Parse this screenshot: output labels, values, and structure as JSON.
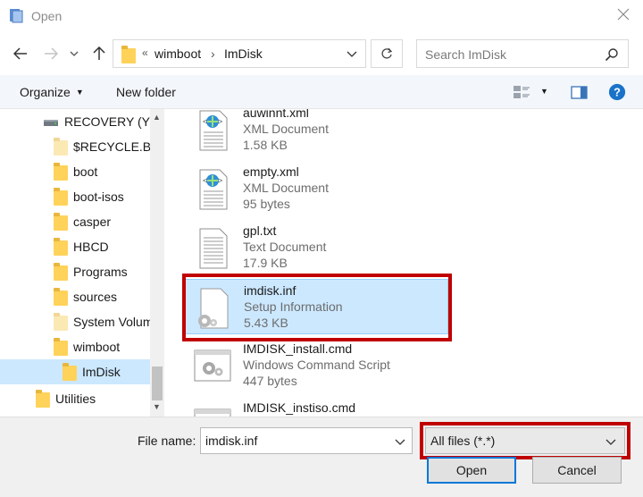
{
  "window": {
    "title": "Open"
  },
  "address": {
    "overflow": "«",
    "crumbs": [
      "wimboot",
      "ImDisk"
    ]
  },
  "search": {
    "placeholder": "Search ImDisk"
  },
  "toolbar": {
    "organize_label": "Organize",
    "new_folder_label": "New folder"
  },
  "nav_tree": [
    {
      "label": "RECOVERY (Y:)",
      "icon": "drive-icon",
      "selected": false
    },
    {
      "label": "$RECYCLE.BIN",
      "icon": "folder-icon",
      "selected": false
    },
    {
      "label": "boot",
      "icon": "folder-icon",
      "selected": false
    },
    {
      "label": "boot-isos",
      "icon": "folder-icon",
      "selected": false
    },
    {
      "label": "casper",
      "icon": "folder-icon",
      "selected": false
    },
    {
      "label": "HBCD",
      "icon": "folder-icon",
      "selected": false
    },
    {
      "label": "Programs",
      "icon": "folder-icon",
      "selected": false
    },
    {
      "label": "sources",
      "icon": "folder-icon",
      "selected": false
    },
    {
      "label": "System Volume Information",
      "icon": "folder-icon",
      "selected": false
    },
    {
      "label": "wimboot",
      "icon": "folder-icon",
      "selected": false
    },
    {
      "label": "ImDisk",
      "icon": "folder-icon",
      "selected": true
    },
    {
      "label": "Utilities",
      "icon": "folder-icon",
      "selected": false
    }
  ],
  "files": [
    {
      "name": "auwinnt.xml",
      "type": "XML Document",
      "size": "1.58 KB",
      "icon": "xml-document-icon",
      "selected": false
    },
    {
      "name": "empty.xml",
      "type": "XML Document",
      "size": "95 bytes",
      "icon": "xml-document-icon",
      "selected": false
    },
    {
      "name": "gpl.txt",
      "type": "Text Document",
      "size": "17.9 KB",
      "icon": "text-document-icon",
      "selected": false
    },
    {
      "name": "imdisk.inf",
      "type": "Setup Information",
      "size": "5.43 KB",
      "icon": "setup-information-icon",
      "selected": true
    },
    {
      "name": "IMDISK_install.cmd",
      "type": "Windows Command Script",
      "size": "447 bytes",
      "icon": "command-script-icon",
      "selected": false
    },
    {
      "name": "IMDISK_instiso.cmd",
      "type": "",
      "size": "",
      "icon": "command-script-icon",
      "selected": false
    }
  ],
  "bottom": {
    "file_name_label": "File name:",
    "file_name_value": "imdisk.inf",
    "file_type_value": "All files (*.*)",
    "open_label": "Open",
    "cancel_label": "Cancel"
  },
  "colors": {
    "accent": "#0078d7",
    "selection": "#cce8ff",
    "highlight": "#c00000",
    "help": "#1a73c8"
  }
}
